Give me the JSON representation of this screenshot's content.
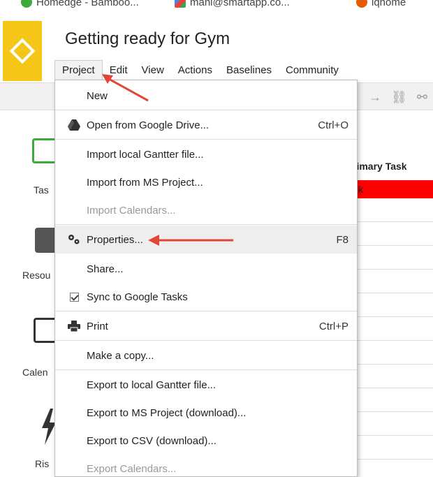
{
  "bookmarks": [
    {
      "label": "Homedge - Bamboo...",
      "icon": "green-circle-icon",
      "color": "#3cab3c"
    },
    {
      "label": "mani@smartapp.co...",
      "icon": "gmail-icon",
      "color": "#4285f4"
    },
    {
      "label": "iqhome",
      "icon": "iqhome-icon",
      "color": "#e65c00"
    }
  ],
  "app": {
    "title": "Getting ready for Gym",
    "logo_color": "#f5c518"
  },
  "menubar": [
    "Project",
    "Edit",
    "View",
    "Actions",
    "Baselines",
    "Community"
  ],
  "nav": [
    {
      "label": "Tas",
      "icon": "task-icon",
      "color": "#3cab3c"
    },
    {
      "label": "Resou",
      "icon": "resource-icon",
      "color": "#555555"
    },
    {
      "label": "Calen",
      "icon": "calendar-icon",
      "color": "#333333"
    },
    {
      "label": "Ris",
      "icon": "risk-icon",
      "color": "#333333"
    }
  ],
  "grid": {
    "column_header": "rimary Task",
    "first_cell": "k",
    "first_row_color": "#ff0000"
  },
  "project_menu": {
    "items": [
      {
        "label": "New",
        "shortcut": "",
        "icon": "",
        "disabled": false
      },
      {
        "label": "Open from Google Drive...",
        "shortcut": "Ctrl+O",
        "icon": "google-drive-icon",
        "disabled": false
      },
      {
        "label": "Import local Gantter file...",
        "shortcut": "",
        "icon": "",
        "disabled": false
      },
      {
        "label": "Import from MS Project...",
        "shortcut": "",
        "icon": "",
        "disabled": false
      },
      {
        "label": "Import Calendars...",
        "shortcut": "",
        "icon": "",
        "disabled": true
      },
      {
        "label": "Properties...",
        "shortcut": "F8",
        "icon": "gears-icon",
        "disabled": false,
        "highlighted": true
      },
      {
        "label": "Share...",
        "shortcut": "",
        "icon": "",
        "disabled": false
      },
      {
        "label": "Sync to Google Tasks",
        "shortcut": "",
        "icon": "checkbox-checked-icon",
        "disabled": false
      },
      {
        "label": "Print",
        "shortcut": "Ctrl+P",
        "icon": "printer-icon",
        "disabled": false
      },
      {
        "label": "Make a copy...",
        "shortcut": "",
        "icon": "",
        "disabled": false
      },
      {
        "label": "Export to local Gantter file...",
        "shortcut": "",
        "icon": "",
        "disabled": false
      },
      {
        "label": "Export to MS Project (download)...",
        "shortcut": "",
        "icon": "",
        "disabled": false
      },
      {
        "label": "Export to CSV (download)...",
        "shortcut": "",
        "icon": "",
        "disabled": false
      },
      {
        "label": "Export Calendars...",
        "shortcut": "",
        "icon": "",
        "disabled": true
      }
    ]
  },
  "annotation_color": "#e0473a"
}
